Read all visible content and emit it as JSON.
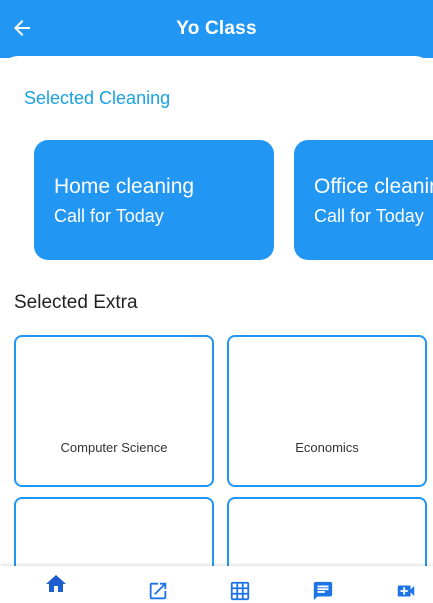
{
  "app_bar": {
    "title": "Yo Class",
    "back_icon": "arrow-left-icon"
  },
  "cleaning_section": {
    "title": "Selected Cleaning",
    "cards": [
      {
        "title": "Home cleaning",
        "subtitle": "Call for Today"
      },
      {
        "title": "Office cleaning",
        "subtitle": "Call for Today"
      }
    ]
  },
  "extra_section": {
    "title": "Selected Extra",
    "tiles": [
      {
        "label": "Computer Science"
      },
      {
        "label": "Economics"
      },
      {
        "label": ""
      },
      {
        "label": ""
      }
    ]
  },
  "bottom_nav": {
    "items": [
      {
        "icon": "home-icon",
        "active": true
      },
      {
        "icon": "open-in-new-icon",
        "active": false
      },
      {
        "icon": "grid-icon",
        "active": false
      },
      {
        "icon": "chat-icon",
        "active": false
      },
      {
        "icon": "video-add-icon",
        "active": false
      }
    ]
  },
  "colors": {
    "primary": "#2196f3",
    "accent_text": "#1aa3e0",
    "nav_active": "#1e5fcf",
    "nav_inactive": "#1e74e6"
  }
}
